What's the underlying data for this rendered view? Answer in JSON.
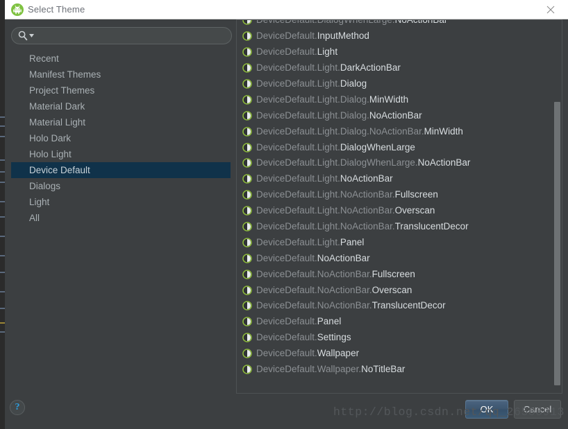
{
  "window": {
    "title": "Select Theme",
    "app_icon": "android-studio-icon",
    "close_label": "✕"
  },
  "search": {
    "value": "",
    "placeholder": "",
    "icon": "search-icon",
    "dropdown_icon": "caret-down-icon"
  },
  "sidebar": {
    "items": [
      {
        "label": "Recent",
        "selected": false
      },
      {
        "label": "Manifest Themes",
        "selected": false
      },
      {
        "label": "Project Themes",
        "selected": false
      },
      {
        "label": "Material Dark",
        "selected": false
      },
      {
        "label": "Material Light",
        "selected": false
      },
      {
        "label": "Holo Dark",
        "selected": false
      },
      {
        "label": "Holo Light",
        "selected": false
      },
      {
        "label": "Device Default",
        "selected": true
      },
      {
        "label": "Dialogs",
        "selected": false
      },
      {
        "label": "Light",
        "selected": false
      },
      {
        "label": "All",
        "selected": false
      }
    ]
  },
  "theme_list": {
    "icon": "theme-contrast-icon",
    "items": [
      "DeviceDefault.DialogWhenLarge.NoActionBar",
      "DeviceDefault.InputMethod",
      "DeviceDefault.Light",
      "DeviceDefault.Light.DarkActionBar",
      "DeviceDefault.Light.Dialog",
      "DeviceDefault.Light.Dialog.MinWidth",
      "DeviceDefault.Light.Dialog.NoActionBar",
      "DeviceDefault.Light.Dialog.NoActionBar.MinWidth",
      "DeviceDefault.Light.DialogWhenLarge",
      "DeviceDefault.Light.DialogWhenLarge.NoActionBar",
      "DeviceDefault.Light.NoActionBar",
      "DeviceDefault.Light.NoActionBar.Fullscreen",
      "DeviceDefault.Light.NoActionBar.Overscan",
      "DeviceDefault.Light.NoActionBar.TranslucentDecor",
      "DeviceDefault.Light.Panel",
      "DeviceDefault.NoActionBar",
      "DeviceDefault.NoActionBar.Fullscreen",
      "DeviceDefault.NoActionBar.Overscan",
      "DeviceDefault.NoActionBar.TranslucentDecor",
      "DeviceDefault.Panel",
      "DeviceDefault.Settings",
      "DeviceDefault.Wallpaper",
      "DeviceDefault.Wallpaper.NoTitleBar"
    ]
  },
  "scrollbar": {
    "thumb_top_pct": 22,
    "thumb_height_pct": 76
  },
  "footer": {
    "help_label": "?",
    "ok_label": "OK",
    "cancel_label": "Cancel"
  },
  "watermark": {
    "text": "http://blog.csdn.net/qq_26588913"
  },
  "colors": {
    "dialog_bg": "#3c3f41",
    "titlebar_bg": "#ffffff",
    "selection_bg": "#10324a",
    "icon_green": "#8cb83c",
    "accent_blue": "#2d9ee0",
    "leaf_text": "#d8dde0",
    "dim_text": "#8c9094"
  }
}
